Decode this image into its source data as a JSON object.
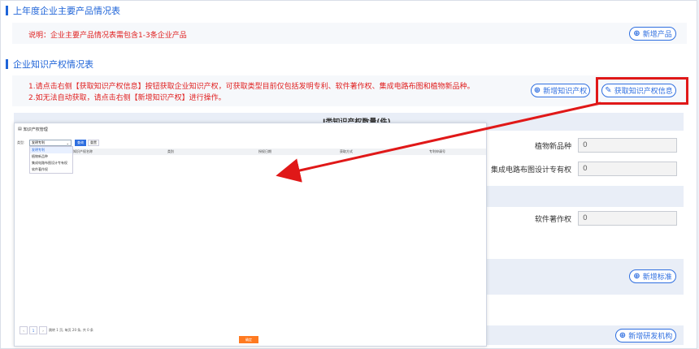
{
  "sections": {
    "products_title": "上年度企业主要产品情况表",
    "products_note": "说明：企业主要产品情况表需包含1-3条企业产品",
    "add_product": "新增产品",
    "ip_title": "企业知识产权情况表",
    "ip_note_1": "1.请点击右侧【获取知识产权信息】按钮获取企业知识产权，可获取类型目前仅包括发明专利、软件著作权、集成电路布图和植物新品种。",
    "ip_note_2": "2.如无法自动获取，请点击右侧【新增知识产权】进行操作。",
    "add_ip": "新增知识产权",
    "fetch_ip": "获取知识产权信息",
    "hidden_header": "Ⅰ类知识产权数量(件)",
    "add_standard": "新增标准",
    "add_rd": "新增研发机构"
  },
  "fields": [
    {
      "label": "植物新品种",
      "value": "0"
    },
    {
      "label": "集成电路布图设计专有权",
      "value": "0"
    },
    {
      "label": "软件著作权",
      "value": "0"
    }
  ],
  "modal": {
    "title": "知识产权管理",
    "type_label": "类型:",
    "type_value": "发明专利",
    "query": "查询",
    "reset": "重置",
    "columns": [
      "知识产权名称",
      "类别",
      "授权日期",
      "获取方式",
      "专利申请号"
    ],
    "options": [
      "发明专利",
      "植物新品种",
      "集成电路布图设计专有权",
      "软件著作权"
    ],
    "pager_text": "跳转 1 页, 每页 20 条, 共 0 条",
    "page_num": "1",
    "confirm": "确定"
  },
  "colors": {
    "accent": "#1f64d8",
    "warning": "#e02020",
    "highlight": "#e01818",
    "confirm": "#ff7a21"
  }
}
